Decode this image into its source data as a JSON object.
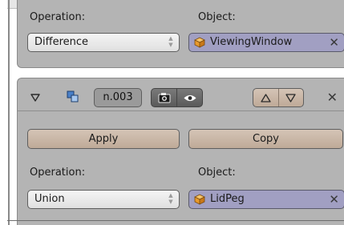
{
  "top_panel": {
    "operation_label": "Operation:",
    "object_label": "Object:",
    "operation_value": "Difference",
    "object_value": "ViewingWindow"
  },
  "modifier": {
    "name_value": "n.003",
    "apply_label": "Apply",
    "copy_label": "Copy",
    "operation_label": "Operation:",
    "object_label": "Object:",
    "operation_value": "Union",
    "object_value": "LidPeg"
  },
  "icons": {
    "collapse": "triangle-down-icon",
    "modifier_type": "boolean-modifier-icon",
    "render": "camera-icon",
    "viewport": "eye-icon",
    "move_up": "arrow-up-icon",
    "move_down": "arrow-down-icon",
    "delete": "close-icon",
    "object": "cube-icon"
  },
  "colors": {
    "panel_bg": "#b4b4b4",
    "button": "#c9b8a8",
    "object_field": "#a19fc2",
    "cube_orange": "#e89a2c"
  }
}
